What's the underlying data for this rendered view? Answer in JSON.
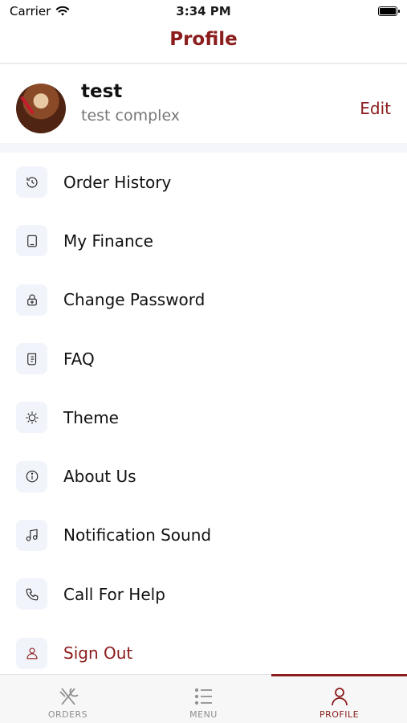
{
  "status_bar": {
    "carrier": "Carrier",
    "time": "3:34 PM"
  },
  "header": {
    "title": "Profile"
  },
  "profile": {
    "name": "test",
    "subtitle": "test complex",
    "edit_label": "Edit"
  },
  "menu": [
    {
      "label": "Order History",
      "icon": "history-icon"
    },
    {
      "label": "My Finance",
      "icon": "tablet-icon"
    },
    {
      "label": "Change Password",
      "icon": "lock-icon"
    },
    {
      "label": "FAQ",
      "icon": "scroll-icon"
    },
    {
      "label": "Theme",
      "icon": "sun-icon"
    },
    {
      "label": "About Us",
      "icon": "info-icon"
    },
    {
      "label": "Notification Sound",
      "icon": "music-note-icon"
    },
    {
      "label": "Call For Help",
      "icon": "phone-icon"
    },
    {
      "label": "Sign Out",
      "icon": "user-icon"
    }
  ],
  "tabs": [
    {
      "label": "ORDERS",
      "icon": "fork-knife-icon",
      "active": false
    },
    {
      "label": "MENU",
      "icon": "list-icon",
      "active": false
    },
    {
      "label": "PROFILE",
      "icon": "user-icon",
      "active": true
    }
  ],
  "colors": {
    "accent": "#8b1c1c",
    "icon_bg": "#f2f4fb",
    "separator": "#f5f6fb"
  }
}
